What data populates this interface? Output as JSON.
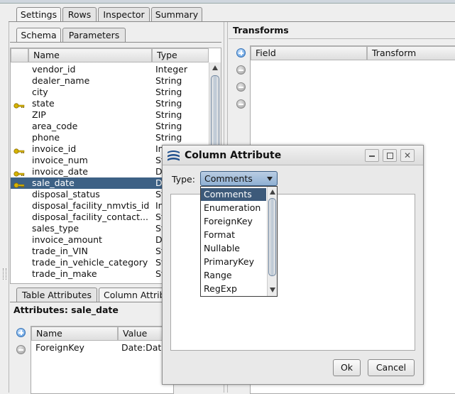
{
  "main_tabs": [
    "Settings",
    "Rows",
    "Inspector",
    "Summary"
  ],
  "sub_tabs": [
    "Schema",
    "Parameters"
  ],
  "schema": {
    "columns": [
      "Name",
      "Type"
    ],
    "rows": [
      {
        "name": "vendor_id",
        "type": "Integer",
        "key": false
      },
      {
        "name": "dealer_name",
        "type": "String",
        "key": false
      },
      {
        "name": "city",
        "type": "String",
        "key": false
      },
      {
        "name": "state",
        "type": "String",
        "key": true
      },
      {
        "name": "ZIP",
        "type": "String",
        "key": false
      },
      {
        "name": "area_code",
        "type": "String",
        "key": false
      },
      {
        "name": "phone",
        "type": "String",
        "key": false
      },
      {
        "name": "invoice_id",
        "type": "In",
        "key": true
      },
      {
        "name": "invoice_num",
        "type": "St",
        "key": false
      },
      {
        "name": "invoice_date",
        "type": "D",
        "key": true
      },
      {
        "name": "sale_date",
        "type": "D",
        "key": true,
        "selected": true
      },
      {
        "name": "disposal_status",
        "type": "St",
        "key": false
      },
      {
        "name": "disposal_facility_nmvtis_id",
        "type": "In",
        "key": false
      },
      {
        "name": "disposal_facility_contact...",
        "type": "St",
        "key": false
      },
      {
        "name": "sales_type",
        "type": "St",
        "key": false
      },
      {
        "name": "invoice_amount",
        "type": "D",
        "key": false
      },
      {
        "name": "trade_in_VIN",
        "type": "St",
        "key": false
      },
      {
        "name": "trade_in_vehicle_category",
        "type": "St",
        "key": false
      },
      {
        "name": "trade_in_make",
        "type": "St",
        "key": false
      }
    ]
  },
  "bottom_tabs": [
    "Table Attributes",
    "Column Attrib"
  ],
  "attributes": {
    "title": "Attributes: sale_date",
    "columns": [
      "Name",
      "Value"
    ],
    "rows": [
      {
        "name": "ForeignKey",
        "value": "Date:Dat"
      }
    ]
  },
  "transforms": {
    "title": "Transforms",
    "columns": [
      "Field",
      "Transform"
    ]
  },
  "dialog": {
    "title": "Column Attribute",
    "type_label": "Type:",
    "selected": "Comments",
    "options": [
      "Comments",
      "Enumeration",
      "ForeignKey",
      "Format",
      "Nullable",
      "PrimaryKey",
      "Range",
      "RegExp"
    ],
    "ok_label": "Ok",
    "cancel_label": "Cancel"
  },
  "colors": {
    "selection": "#3d6185",
    "dialog_list_selection": "#3d5a7a"
  }
}
